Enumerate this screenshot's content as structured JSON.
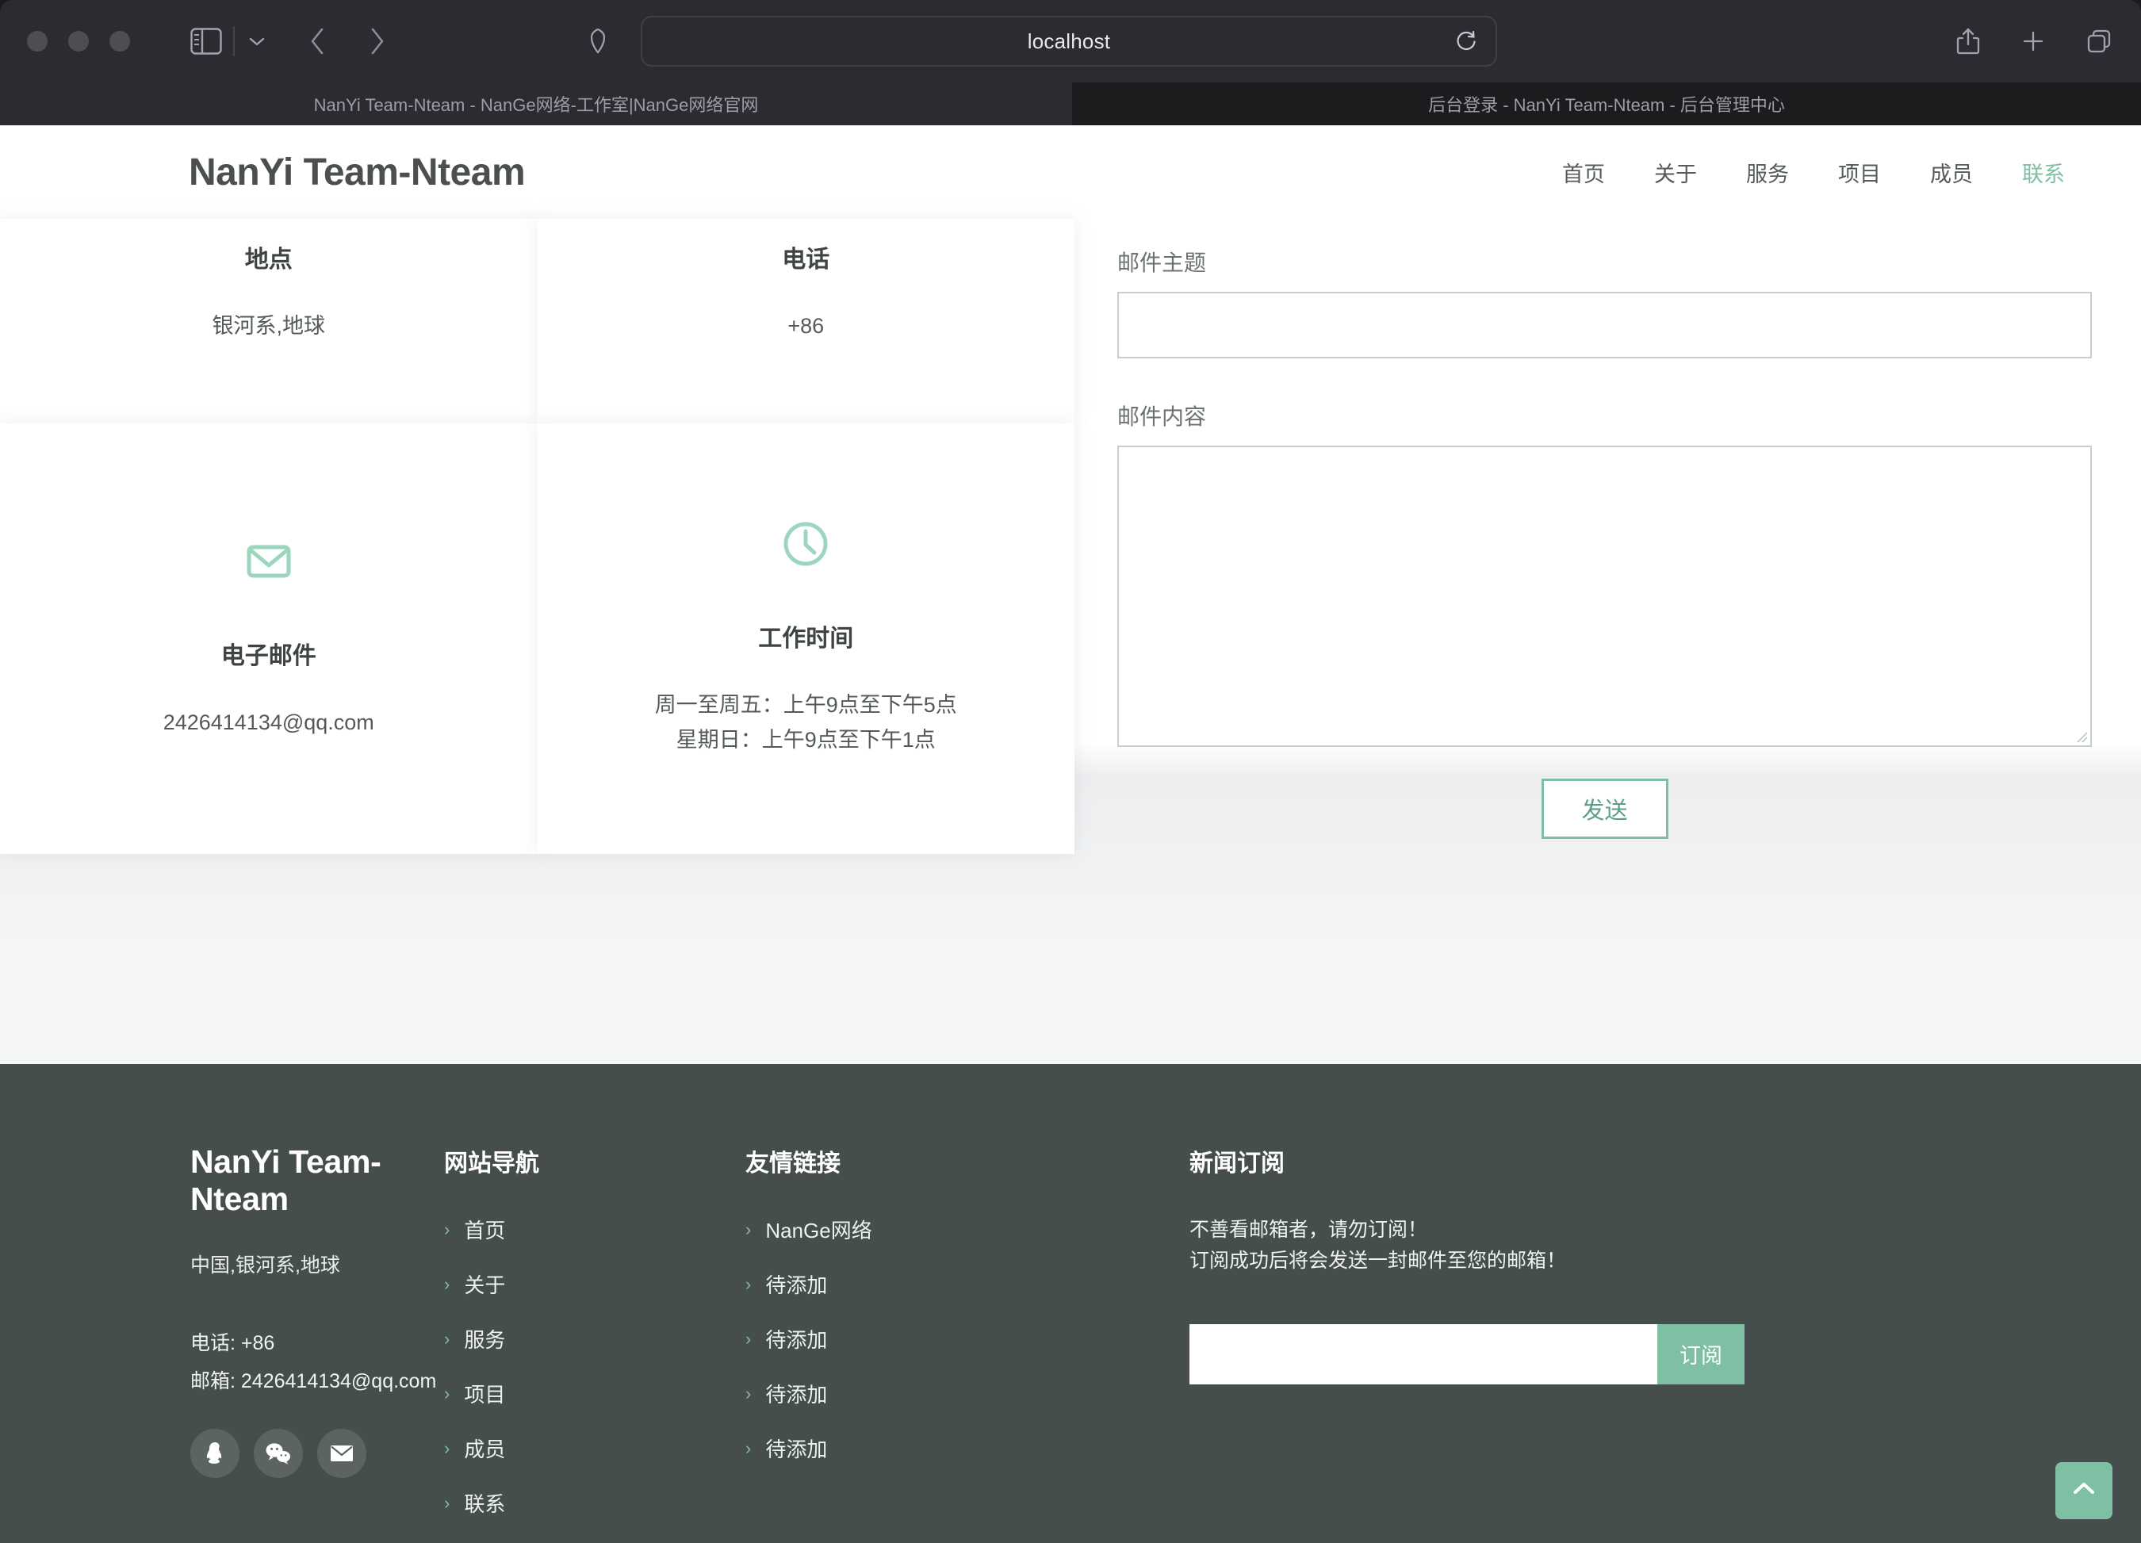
{
  "browser": {
    "url": "localhost",
    "tabs": [
      {
        "title": "NanYi Team-Nteam - NanGe网络-工作室|NanGe网络官网",
        "active": true
      },
      {
        "title": "后台登录 - NanYi Team-Nteam - 后台管理中心",
        "active": false
      }
    ],
    "toolbar": {
      "sidebar": "sidebar-icon",
      "tab_overview": "chevron-down-icon",
      "back": "back-icon",
      "forward": "forward-icon",
      "shield": "shield-icon",
      "reload": "reload-icon",
      "share": "share-icon",
      "new_tab": "plus-icon",
      "tab_switcher": "tabs-icon"
    }
  },
  "site": {
    "brand": "NanYi Team-Nteam",
    "nav": [
      {
        "label": "首页",
        "active": false
      },
      {
        "label": "关于",
        "active": false
      },
      {
        "label": "服务",
        "active": false
      },
      {
        "label": "项目",
        "active": false
      },
      {
        "label": "成员",
        "active": false
      },
      {
        "label": "联系",
        "active": true
      }
    ]
  },
  "contact_cards": [
    {
      "icon": "location-icon",
      "title": "地点",
      "lines": [
        "银河系,地球"
      ]
    },
    {
      "icon": "phone-icon",
      "title": "电话",
      "lines": [
        "+86"
      ]
    },
    {
      "icon": "mail-icon",
      "title": "电子邮件",
      "lines": [
        "2426414134@qq.com"
      ]
    },
    {
      "icon": "clock-icon",
      "title": "工作时间",
      "lines": [
        "周一至周五：上午9点至下午5点",
        "星期日：上午9点至下午1点"
      ]
    }
  ],
  "form": {
    "subject_label": "邮件主题",
    "subject_value": "",
    "subject_placeholder": "",
    "body_label": "邮件内容",
    "body_value": "",
    "body_placeholder": "",
    "send_label": "发送"
  },
  "footer": {
    "brand": "NanYi Team-Nteam",
    "address": "中国,银河系,地球",
    "phone": "电话: +86",
    "email": "邮箱: 2426414134@qq.com",
    "socials": [
      {
        "name": "qq-icon"
      },
      {
        "name": "wechat-icon"
      },
      {
        "name": "mail-icon"
      }
    ],
    "nav_heading": "网站导航",
    "nav_items": [
      {
        "label": "首页"
      },
      {
        "label": "关于"
      },
      {
        "label": "服务"
      },
      {
        "label": "项目"
      },
      {
        "label": "成员"
      },
      {
        "label": "联系"
      }
    ],
    "links_heading": "友情链接",
    "links_items": [
      {
        "label": "NanGe网络"
      },
      {
        "label": "待添加"
      },
      {
        "label": "待添加"
      },
      {
        "label": "待添加"
      },
      {
        "label": "待添加"
      }
    ],
    "news_heading": "新闻订阅",
    "news_line1": "不善看邮箱者，请勿订阅！",
    "news_line2": "订阅成功后将会发送一封邮件至您的邮箱！",
    "sub_value": "",
    "sub_placeholder": "",
    "sub_button": "订阅"
  },
  "to_top": {
    "icon": "chevron-up-icon"
  },
  "colors": {
    "accent": "#7fc0a5",
    "footer_bg": "#454d4d",
    "text_dark": "#3e4443",
    "chrome_bg": "#2b2b31"
  }
}
